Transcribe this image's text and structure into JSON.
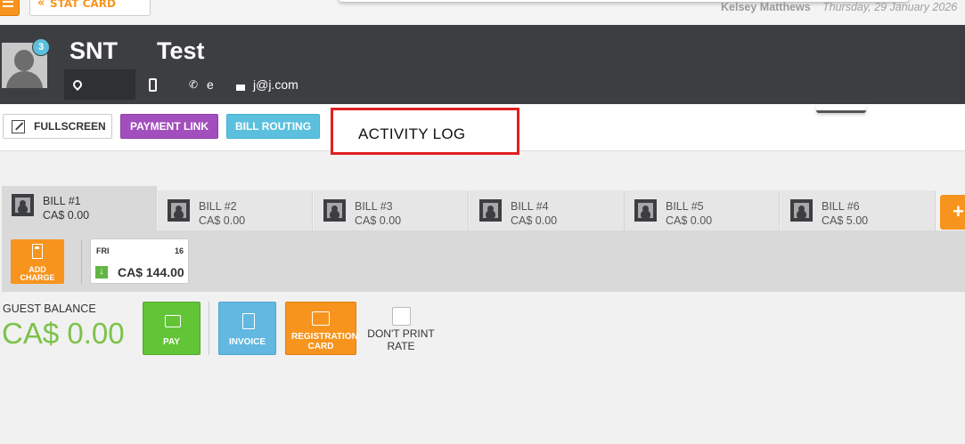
{
  "topbar": {
    "stat_card_label": "STAT CARD",
    "user_name": "Kelsey Matthews",
    "date": "Thursday, 29 January 2026"
  },
  "guest": {
    "notification_count": "3",
    "first_name": "SNT",
    "last_name": "Test",
    "phone": "e",
    "email": "j@j.com"
  },
  "toolbar": {
    "fullscreen_label": "FULLSCREEN",
    "payment_link_label": "PAYMENT LINK",
    "bill_routing_label": "BILL ROUTING",
    "activity_log_label": "ACTIVITY LOG"
  },
  "bills": [
    {
      "name": "BILL #1",
      "amount": "CA$ 0.00"
    },
    {
      "name": "BILL #2",
      "amount": "CA$ 0.00"
    },
    {
      "name": "BILL #3",
      "amount": "CA$ 0.00"
    },
    {
      "name": "BILL #4",
      "amount": "CA$ 0.00"
    },
    {
      "name": "BILL #5",
      "amount": "CA$ 0.00"
    },
    {
      "name": "BILL #6",
      "amount": "CA$ 5.00"
    }
  ],
  "add_bill_label": "+",
  "charges": {
    "add_charge_label": "ADD CHARGE",
    "day": {
      "weekday": "FRI",
      "day_number": "16",
      "amount": "CA$ 144.00"
    }
  },
  "balance": {
    "label": "GUEST BALANCE",
    "value": "CA$ 0.00"
  },
  "actions": {
    "pay_label": "PAY",
    "invoice_label": "INVOICE",
    "registration_card_label": "REGISTRATION CARD",
    "dont_print_rate_label": "DON'T PRINT RATE"
  },
  "colors": {
    "header_bg": "#3d3e42",
    "accent_orange": "#f7941d",
    "payment_link_purple": "#a24fbd",
    "bill_routing_blue": "#5bc0de",
    "pay_green": "#62c437",
    "balance_green": "#7cc24a",
    "highlight_red": "#e02020"
  }
}
